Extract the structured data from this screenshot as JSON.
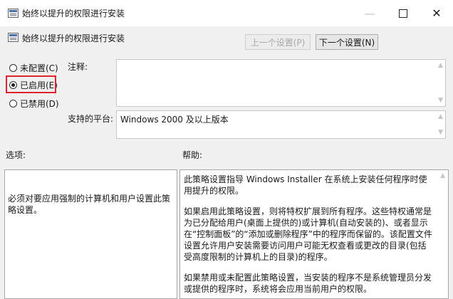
{
  "window": {
    "title": "始终以提升的权限进行安装"
  },
  "header": {
    "policy_name": "始终以提升的权限进行安装"
  },
  "nav": {
    "prev_label": "上一个设置(P)",
    "next_label": "下一个设置(N)"
  },
  "state_options": [
    {
      "label": "未配置(C)",
      "selected": false
    },
    {
      "label": "已启用(E)",
      "selected": true
    },
    {
      "label": "已禁用(D)",
      "selected": false
    }
  ],
  "highlight_color": "#e0242b",
  "comment": {
    "label": "注释:",
    "value": ""
  },
  "platform": {
    "label": "支持的平台:",
    "value": "Windows 2000 及以上版本"
  },
  "sections": {
    "options_label": "选项:",
    "help_label": "帮助:"
  },
  "options_text": "必须对要应用强制的计算机和用户设置此策略设置。",
  "help": {
    "paragraphs": [
      "此策略设置指导 Windows Installer 在系统上安装任何程序时使用提升的权限。",
      "如果启用此策略设置，则将特权扩展到所有程序。这些特权通常是为已分配给用户(桌面上提供的)或计算机(自动安装的)、或者显示在“控制面板”的“添加或删除程序”中的程序而保留的。该配置文件设置允许用户安装需要访问用户可能无权查看或更改的目录(包括受高度限制的计算机上的目录)的程序。",
      "如果禁用或未配置此策略设置，当安装的程序不是系统管理员分发或提供的程序时，系统将会应用当前用户的权限。"
    ]
  }
}
